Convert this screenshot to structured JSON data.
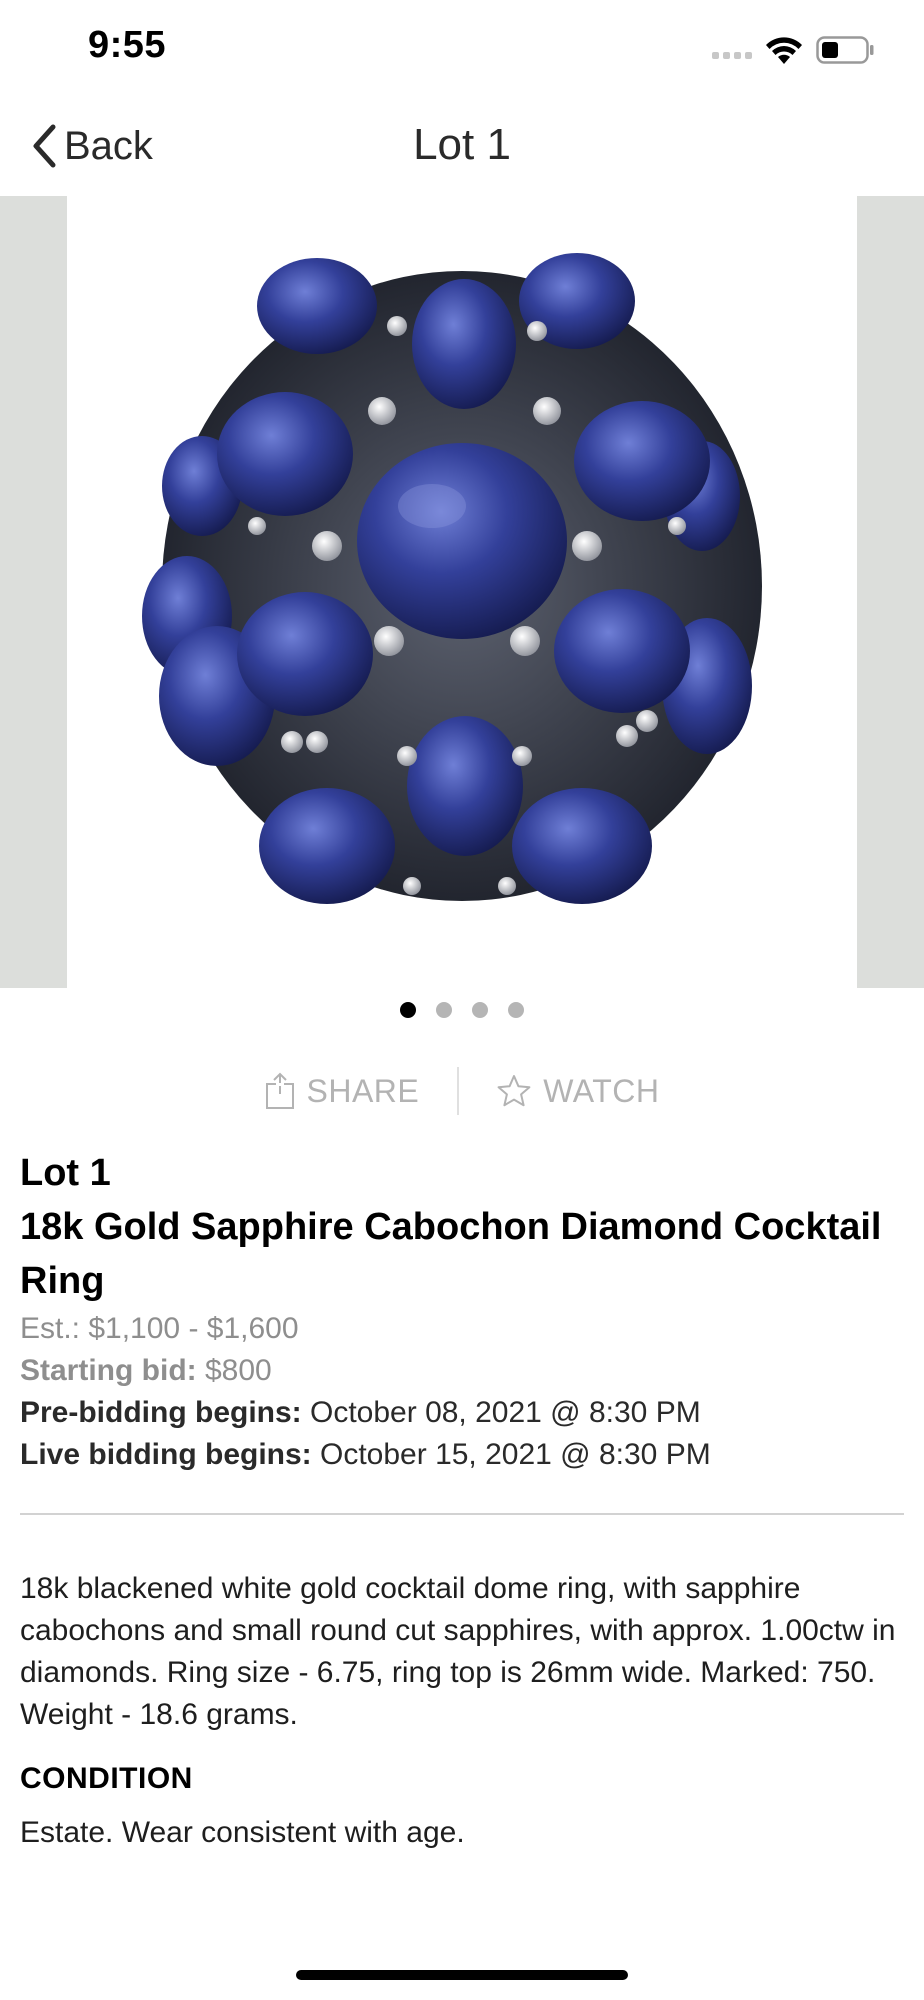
{
  "status": {
    "time": "9:55"
  },
  "nav": {
    "back_label": "Back",
    "title": "Lot 1"
  },
  "gallery": {
    "image_alt": "18k Gold Sapphire Cabochon Diamond Cocktail Ring",
    "page_count": 4,
    "active_page": 1
  },
  "actions": {
    "share_label": "SHARE",
    "watch_label": "WATCH"
  },
  "lot": {
    "number": "Lot 1",
    "title": "18k Gold Sapphire Cabochon Diamond Cocktail Ring",
    "estimate": "Est.: $1,100 - $1,600",
    "starting_bid_label": "Starting bid:",
    "starting_bid_value": "$800",
    "prebid_label": "Pre-bidding begins:",
    "prebid_value": "October 08, 2021 @ 8:30 PM",
    "live_label": "Live bidding begins:",
    "live_value": "October 15, 2021 @ 8:30 PM"
  },
  "description": "18k blackened white gold cocktail dome ring, with sapphire cabochons and small round cut sapphires, with approx. 1.00ctw in diamonds. Ring size - 6.75, ring top is 26mm wide. Marked: 750. Weight - 18.6 grams.",
  "condition": {
    "heading": "CONDITION",
    "text": "Estate. Wear consistent with age."
  },
  "colors": {
    "gallery_bg": "#dcdedb",
    "sapphire": "#2f3c94",
    "muted_text": "#8e8e8e",
    "action_text": "#b3b3b3"
  },
  "icons": [
    "wifi-icon",
    "battery-icon",
    "back-chevron-icon",
    "share-icon",
    "star-icon"
  ]
}
